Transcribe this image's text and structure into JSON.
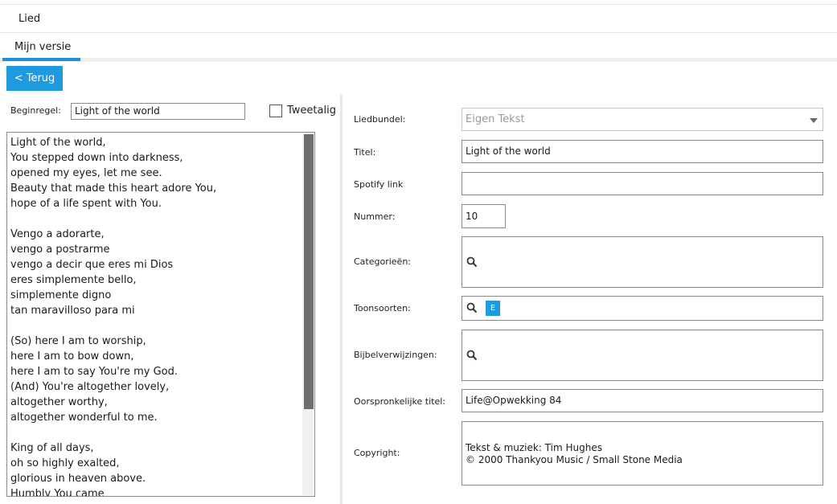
{
  "header": {
    "title": "Lied"
  },
  "tabs": [
    {
      "label": "Mijn versie",
      "active": true
    }
  ],
  "back_button": {
    "label": "< Terug"
  },
  "left": {
    "beginregel_label": "Beginregel:",
    "beginregel_value": "Light of the world",
    "tweetalig_label": "Tweetalig",
    "tweetalig_checked": false,
    "lyrics": "Light of the world,\nYou stepped down into darkness,\nopened my eyes, let me see.\nBeauty that made this heart adore You,\nhope of a life spent with You.\n\nVengo a adorarte,\nvengo a postrarme\nvengo a decir que eres mi Dios\neres simplemente bello,\nsimplemente digno\ntan maravilloso para mi\n\n(So) here I am to worship,\nhere I am to bow down,\nhere I am to say You're my God.\n(And) You're altogether lovely,\naltogether worthy,\naltogether wonderful to me.\n\nKing of all days,\noh so highly exalted,\nglorious in heaven above.\nHumbly You came"
  },
  "form": {
    "liedbundel": {
      "label": "Liedbundel:",
      "value": "Eigen Tekst"
    },
    "titel": {
      "label": "Titel:",
      "value": "Light of the world"
    },
    "spotify": {
      "label": "Spotify link",
      "value": ""
    },
    "nummer": {
      "label": "Nummer:",
      "value": "10"
    },
    "categorieen": {
      "label": "Categorieën:"
    },
    "toonsoorten": {
      "label": "Toonsoorten:",
      "tag": "E"
    },
    "bijbelverwijzingen": {
      "label": "Bijbelverwijzingen:"
    },
    "oorspronkelijke_titel": {
      "label": "Oorspronkelijke titel:",
      "value": "Life@Opwekking 84"
    },
    "copyright": {
      "label": "Copyright:",
      "value": "Tekst & muziek: Tim Hughes\n© 2000 Thankyou Music / Small Stone Media"
    }
  },
  "colors": {
    "accent": "#1e9ade",
    "border": "#8a8a8a",
    "scroll_thumb": "#6e6e6e"
  },
  "icons": {
    "search": "search-icon",
    "dropdown": "chevron-down-icon"
  }
}
